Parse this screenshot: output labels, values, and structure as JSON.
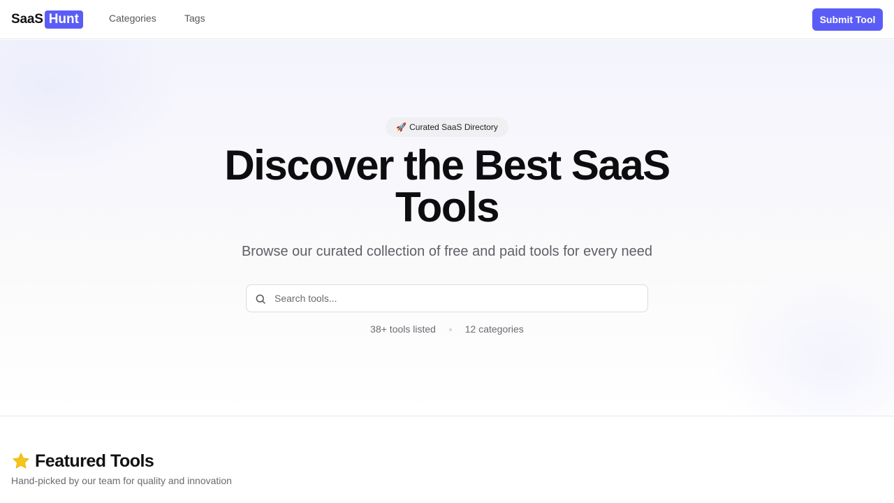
{
  "header": {
    "logo_text": "SaaS",
    "logo_badge": "Hunt",
    "nav": [
      {
        "label": "Categories"
      },
      {
        "label": "Tags"
      }
    ],
    "submit_label": "Submit Tool"
  },
  "hero": {
    "pill_emoji": "🚀",
    "pill_label": "Curated SaaS Directory",
    "title_line1": "Discover the Best SaaS",
    "title_line2": "Tools",
    "subtitle": "Browse our curated collection of free and paid tools for every need",
    "search": {
      "placeholder": "Search tools...",
      "icon": "search-icon"
    },
    "stats": {
      "tools": "38+ tools listed",
      "categories": "12 categories"
    }
  },
  "featured": {
    "icon": "star-icon",
    "title": "Featured Tools",
    "subtitle": "Hand-picked by our team for quality and innovation"
  },
  "colors": {
    "accent": "#5b5cf6",
    "star": "#f5c518",
    "text": "#111111",
    "muted": "#6a6a72"
  }
}
